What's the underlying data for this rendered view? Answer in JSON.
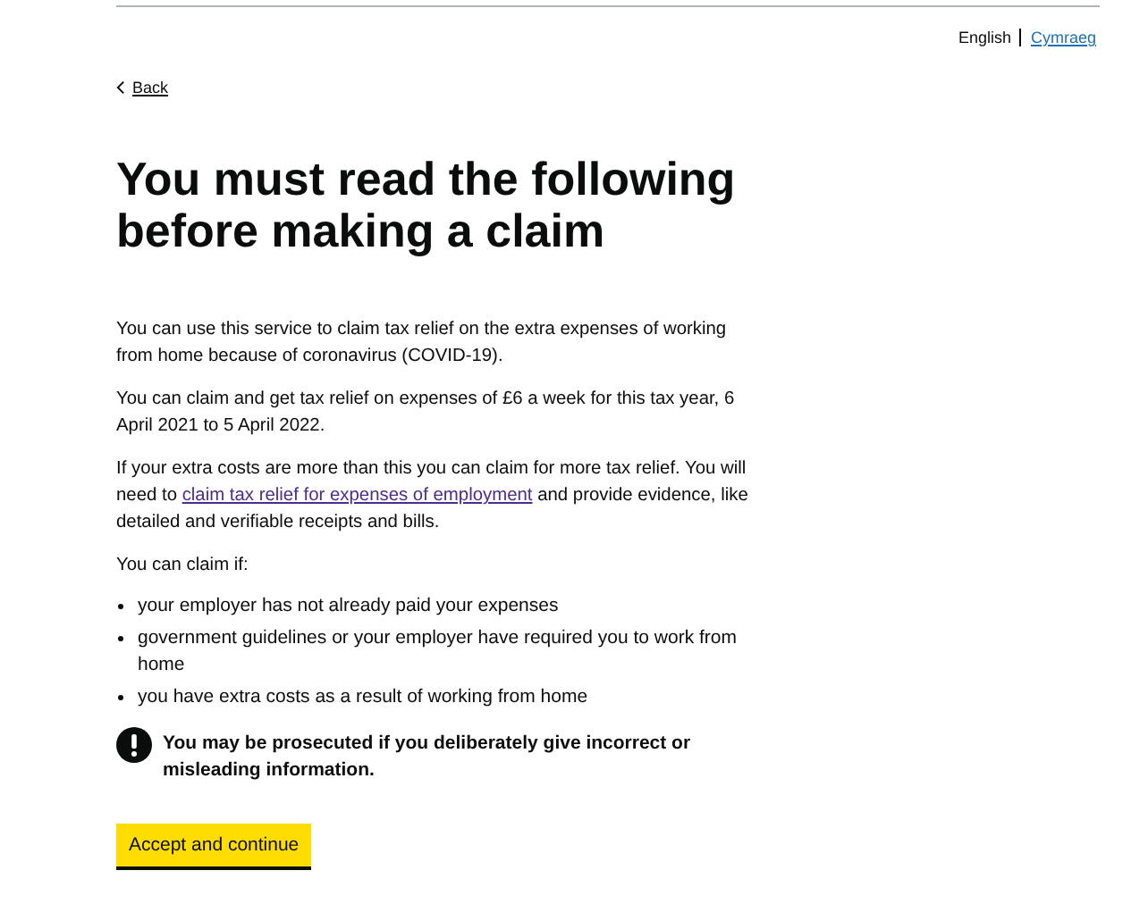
{
  "languages": [
    {
      "label": "English",
      "selected": true
    },
    {
      "label": "Cymraeg",
      "selected": false
    }
  ],
  "back_link": "Back",
  "heading": "You must read the following before making a claim",
  "paragraphs": [
    {
      "kind": "text",
      "text": "You can use this service to claim tax relief on the extra expenses of working from home because of coronavirus (COVID-19)."
    },
    {
      "kind": "text",
      "text": "You can claim and get tax relief on expenses of £6 a week for this tax year, 6 April 2021 to 5 April 2022."
    },
    {
      "kind": "link",
      "before": "If your extra costs are more than this you can claim for more tax relief. You will need to ",
      "link": "claim tax relief for expenses of employment",
      "after": " and provide evidence, like detailed and verifiable receipts and bills."
    },
    {
      "kind": "text",
      "text": "You can claim if:"
    }
  ],
  "conditions": [
    "your employer has not already paid your expenses",
    "government guidelines or your employer have required you to work from home",
    "you have extra costs as a result of working from home"
  ],
  "warning": "You may be prosecuted if you deliberately give incorrect or misleading information.",
  "button": "Accept and continue"
}
